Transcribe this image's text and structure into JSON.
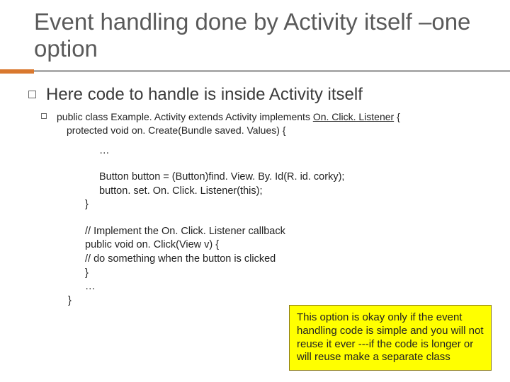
{
  "title": "Event handling done by Activity itself –one option",
  "bullet1": "Here code to handle is inside Activity itself",
  "code": {
    "line1a": "public class Example. Activity extends Activity implements ",
    "line1b": "On. Click. Listener",
    "line1c": " {",
    "line2": "protected void on. Create(Bundle saved. Values) {",
    "ellipsis1": "…",
    "btn1": "Button button = (Button)find. View. By. Id(R. id. corky);",
    "btn2": "button. set. On. Click. Listener(this);",
    "close1": "}",
    "comment1": "// Implement the On. Click. Listener callback",
    "cb1": "public void on. Click(View v) {",
    "cb2": "  // do something when the button is clicked",
    "cb3": "}",
    "ellipsis2": "…",
    "close2": "}"
  },
  "callout": "This option is okay only if the event handling code is simple and you will not reuse it ever ---if the code is longer or will reuse make a separate class"
}
